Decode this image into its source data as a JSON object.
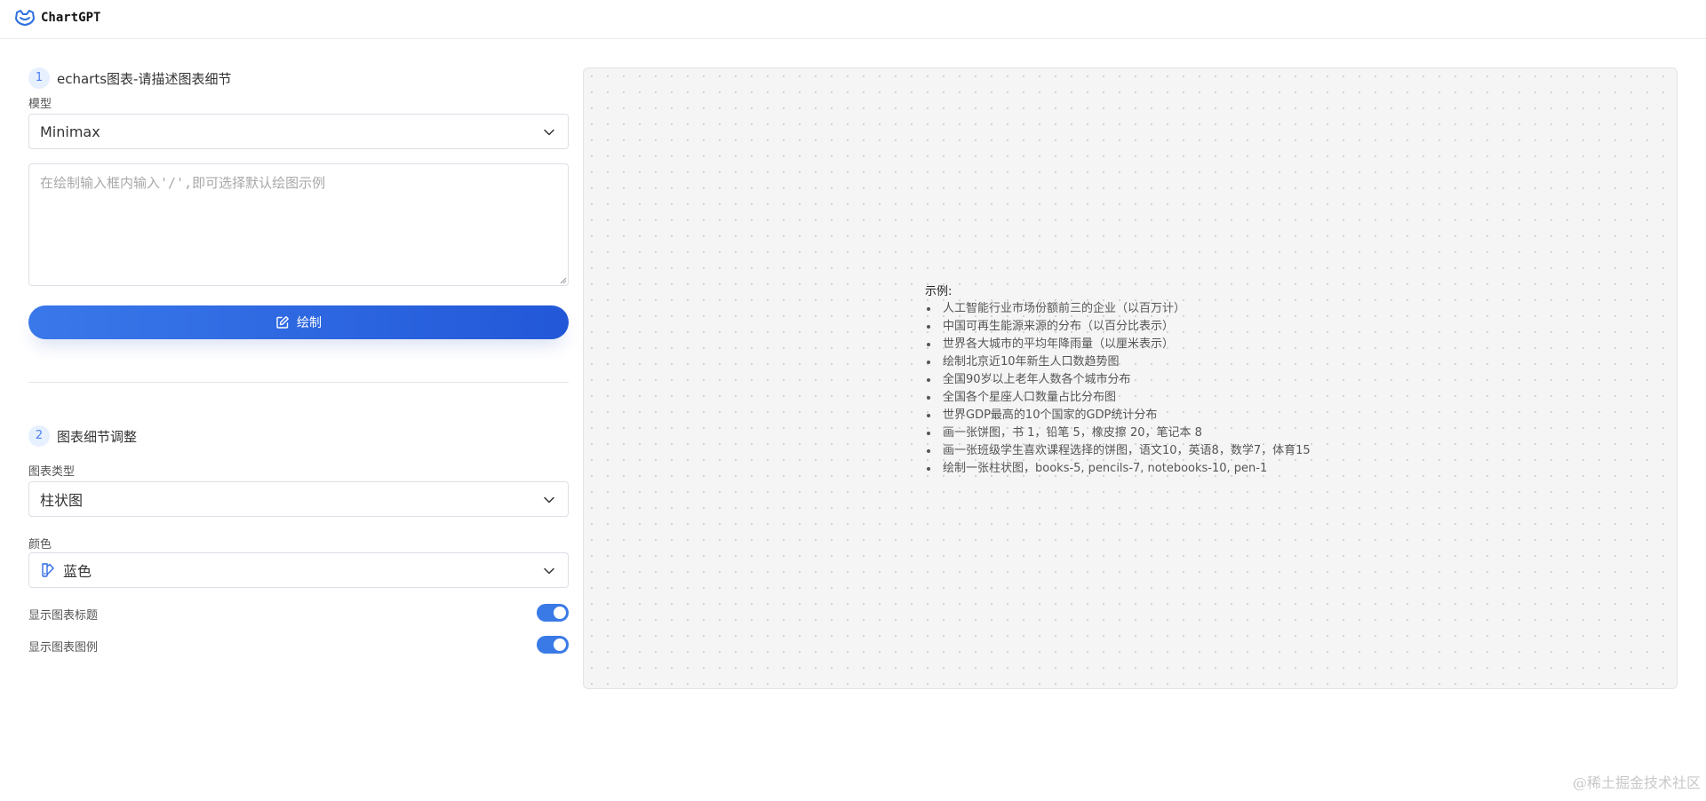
{
  "app": {
    "title": "ChartGPT",
    "logo_icon": "cat-logo-icon"
  },
  "section1": {
    "step": "1",
    "title": "echarts图表-请描述图表细节",
    "model_label": "模型",
    "model_value": "Minimax",
    "prompt_placeholder": "在绘制输入框内输入'/',即可选择默认绘图示例",
    "prompt_value": "",
    "draw_button": "绘制"
  },
  "section2": {
    "step": "2",
    "title": "图表细节调整",
    "chart_type_label": "图表类型",
    "chart_type_value": "柱状图",
    "color_label": "颜色",
    "color_value": "蓝色",
    "show_title_label": "显示图表标题",
    "show_title_on": true,
    "show_legend_label": "显示图表图例",
    "show_legend_on": true
  },
  "examples": {
    "title": "示例:",
    "items": [
      "人工智能行业市场份额前三的企业（以百万计）",
      "中国可再生能源来源的分布（以百分比表示）",
      "世界各大城市的平均年降雨量（以厘米表示）",
      "绘制北京近10年新生人口数趋势图",
      "全国90岁以上老年人数各个城市分布",
      "全国各个星座人口数量占比分布图",
      "世界GDP最高的10个国家的GDP统计分布",
      "画一张饼图，书 1，铅笔 5，橡皮擦 20，笔记本 8",
      "画一张班级学生喜欢课程选择的饼图，语文10，英语8，数学7，体育15",
      "绘制一张柱状图，books-5, pencils-7, notebooks-10, pen-1"
    ]
  },
  "watermark": "@稀土掘金技术社区",
  "colors": {
    "accent": "#2f6be2",
    "toggle_on": "#3a7ae6",
    "step_bg": "#e6f0ff"
  }
}
